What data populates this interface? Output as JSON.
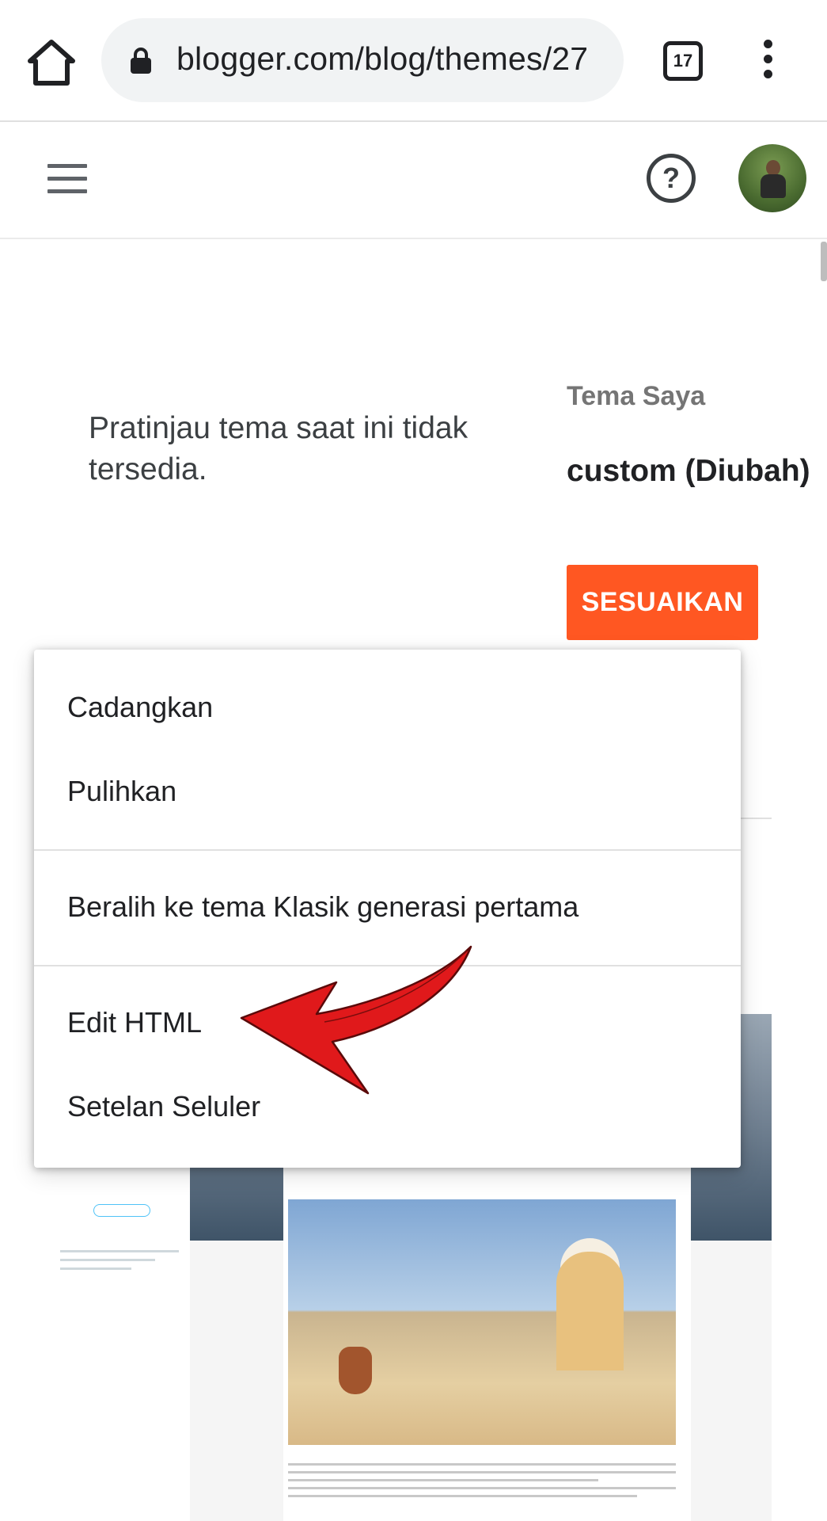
{
  "browser": {
    "url": "blogger.com/blog/themes/27",
    "tab_count": "17"
  },
  "header": {
    "help_symbol": "?"
  },
  "content": {
    "preview_message": "Pratinjau tema saat ini tidak tersedia.",
    "my_theme_label": "Tema Saya",
    "theme_name": "custom (Diubah)",
    "customize_label": "SESUAIKAN"
  },
  "menu": {
    "items": [
      {
        "label": "Cadangkan"
      },
      {
        "label": "Pulihkan"
      },
      {
        "label": "Beralih ke tema Klasik generasi pertama"
      },
      {
        "label": "Edit HTML"
      },
      {
        "label": "Setelan Seluler"
      }
    ]
  },
  "colors": {
    "accent": "#ff5722",
    "annotation_arrow": "#e0191b"
  },
  "icons": [
    "home-icon",
    "lock-icon",
    "tabs-icon",
    "more-vert-icon",
    "menu-icon",
    "help-icon",
    "avatar"
  ]
}
